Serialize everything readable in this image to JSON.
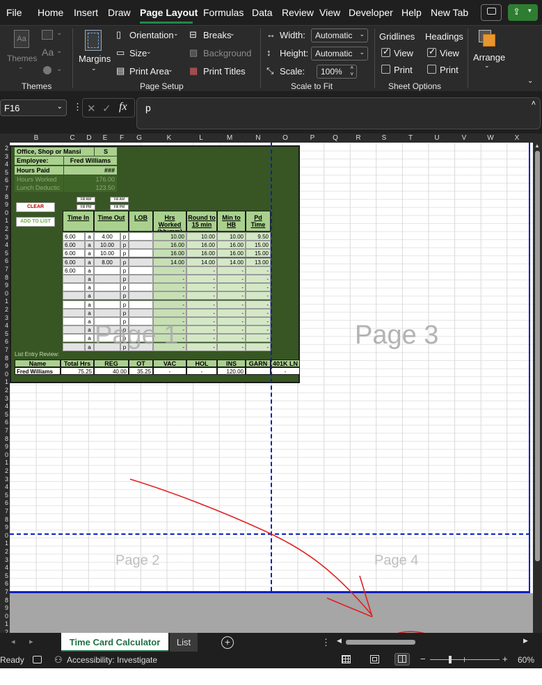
{
  "menu": {
    "items": [
      "File",
      "Home",
      "Insert",
      "Draw",
      "Page Layout",
      "Formulas",
      "Data",
      "Review",
      "View",
      "Developer",
      "Help",
      "New Tab"
    ],
    "active": "Page Layout"
  },
  "ribbon": {
    "themes": {
      "themes_label": "Themes",
      "group_label": "Themes",
      "aa_label": "Aa"
    },
    "page_setup": {
      "margins": "Margins",
      "orientation": "Orientation",
      "size": "Size",
      "print_area": "Print Area",
      "breaks": "Breaks",
      "background": "Background",
      "print_titles": "Print Titles",
      "group_label": "Page Setup"
    },
    "scale_to_fit": {
      "width_label": "Width:",
      "width_value": "Automatic",
      "height_label": "Height:",
      "height_value": "Automatic",
      "scale_label": "Scale:",
      "scale_value": "100%",
      "group_label": "Scale to Fit"
    },
    "sheet_options": {
      "gridlines": "Gridlines",
      "headings": "Headings",
      "view": "View",
      "print": "Print",
      "group_label": "Sheet Options"
    },
    "arrange": {
      "label": "Arrange"
    }
  },
  "formula_bar": {
    "name_box": "F16",
    "fx": "fx",
    "formula": "p"
  },
  "columns": [
    "B",
    "C",
    "D",
    "E",
    "F",
    "G",
    "K",
    "L",
    "M",
    "N",
    "O",
    "P",
    "Q",
    "R",
    "S",
    "T",
    "U",
    "V",
    "W",
    "X"
  ],
  "rows": [
    "2",
    "3",
    "4",
    "5",
    "6",
    "7",
    "8",
    "9",
    "0",
    "1",
    "2",
    "3",
    "4",
    "5",
    "6",
    "7",
    "8",
    "9",
    "0",
    "1",
    "2",
    "3",
    "4",
    "5",
    "6",
    "7",
    "8",
    "9",
    "0",
    "1",
    "2",
    "3",
    "4",
    "5",
    "6",
    "7",
    "8",
    "9",
    "0",
    "1",
    "2",
    "3",
    "4",
    "5",
    "6",
    "7",
    "8",
    "9",
    "0",
    "1",
    "2",
    "3",
    "4",
    "5",
    "6",
    "7",
    "8",
    "9",
    "0",
    "1",
    "2",
    "3",
    "4",
    "5",
    "6",
    "7",
    "8"
  ],
  "card": {
    "office_label": "Office, Shop or Mansi",
    "office_value": "S",
    "employee_label": "Employee:",
    "employee_value": "Fred Williams",
    "hours_paid_label": "Hours Paid",
    "hours_paid_value": "###",
    "hours_worked_label": "Hours Worked",
    "hours_worked_value": "176.00",
    "lunch_label": "Lunch Deductic",
    "lunch_value": "123.50",
    "clear_btn": "CLEAR",
    "add_btn": "ADD TO LIST",
    "fill_am": "Fill AM",
    "fill_pm": "Fill PM",
    "headers": [
      "Time In",
      "Time Out",
      "LOB",
      "Hrs Worked (hh:mm)",
      "Round to 15 min",
      "Min to HB",
      "Pd Time"
    ],
    "rows": [
      [
        "6.00",
        "a",
        "4.00",
        "p",
        "",
        "10.00",
        "10.00",
        "10.00",
        "9.50"
      ],
      [
        "6.00",
        "a",
        "10.00",
        "p",
        "",
        "16.00",
        "16.00",
        "16.00",
        "15.00"
      ],
      [
        "6.00",
        "a",
        "10.00",
        "p",
        "",
        "16.00",
        "16.00",
        "16.00",
        "15.00"
      ],
      [
        "6.00",
        "a",
        "8.00",
        "p",
        "",
        "14.00",
        "14.00",
        "14.00",
        "13.00"
      ],
      [
        "6.00",
        "a",
        "",
        "p",
        "",
        "-",
        "-",
        "-",
        "-"
      ],
      [
        "",
        "a",
        "",
        "p",
        "",
        "-",
        "-",
        "-",
        "-"
      ],
      [
        "",
        "a",
        "",
        "p",
        "",
        "-",
        "-",
        "-",
        "-"
      ],
      [
        "",
        "a",
        "",
        "p",
        "",
        "-",
        "-",
        "-",
        "-"
      ],
      [
        "",
        "a",
        "",
        "p",
        "",
        "-",
        "-",
        "-",
        "-"
      ],
      [
        "",
        "a",
        "",
        "p",
        "",
        "-",
        "-",
        "-",
        "-"
      ],
      [
        "",
        "a",
        "",
        "p",
        "",
        "-",
        "-",
        "-",
        "-"
      ],
      [
        "",
        "a",
        "",
        "p",
        "",
        "-",
        "-",
        "-",
        "-"
      ],
      [
        "",
        "a",
        "",
        "p",
        "",
        "-",
        "-",
        "-",
        "-"
      ],
      [
        "",
        "a",
        "",
        "p",
        "",
        "-",
        "-",
        "-",
        "-"
      ]
    ],
    "list_review": "List Entry Review:",
    "summary_headers": [
      "Name",
      "Total Hrs",
      "REG",
      "OT",
      "VAC",
      "HOL",
      "INS",
      "GARN",
      "401K LN"
    ],
    "summary_values": [
      "Fred Williams",
      "75.25",
      "40.00",
      "35.25",
      "-",
      "-",
      "120.00",
      "",
      "-"
    ]
  },
  "watermarks": {
    "page1": "Page 1",
    "page2": "Page 2",
    "page3": "Page 3",
    "page4": "Page 4"
  },
  "sheet_tabs": [
    "Time Card Calculator",
    "List"
  ],
  "status": {
    "ready": "Ready",
    "accessibility": "Accessibility: Investigate",
    "zoom": "60%"
  },
  "colors": {
    "accent": "#1e8a4c",
    "card_bg": "#375623",
    "header_green": "#a9d08e",
    "page_break": "#0a1fbf",
    "annotation": "#e02020"
  }
}
